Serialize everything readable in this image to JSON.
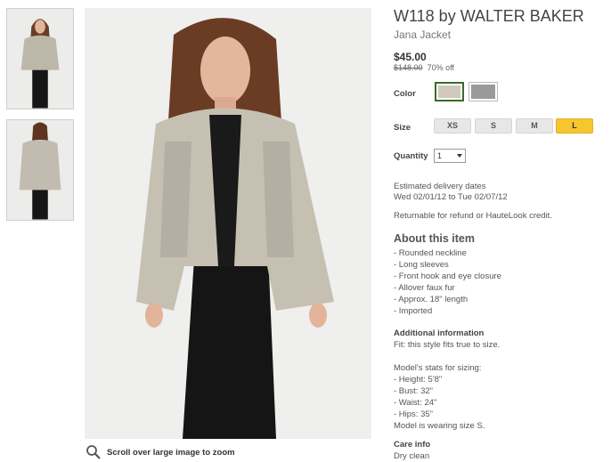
{
  "gallery": {
    "zoom_hint": "Scroll over large image to zoom"
  },
  "product": {
    "brand_line": "W118 by WALTER BAKER",
    "name": "Jana Jacket",
    "price": "$45.00",
    "original_price": "$148.00",
    "discount": "70% off"
  },
  "options": {
    "color_label": "Color",
    "colors": [
      {
        "name": "light faux fur",
        "hex": "#cfc9bd",
        "selected": true
      },
      {
        "name": "grey faux fur",
        "hex": "#9a9a9a",
        "selected": false
      }
    ],
    "size_label": "Size",
    "sizes": [
      "XS",
      "S",
      "M",
      "L"
    ],
    "selected_size": "L",
    "quantity_label": "Quantity",
    "quantity_value": "1"
  },
  "delivery": {
    "heading": "Estimated delivery dates",
    "dates": "Wed 02/01/12 to Tue 02/07/12",
    "returns": "Returnable for refund or HauteLook credit."
  },
  "about": {
    "heading": "About this item",
    "bullets": [
      "- Rounded neckline",
      "- Long sleeves",
      "- Front hook and eye closure",
      "- Allover faux fur",
      "- Approx. 18\" length",
      "- Imported"
    ]
  },
  "additional": {
    "heading": "Additional information",
    "fit": "Fit: this style fits true to size.",
    "model_heading": "Model's stats for sizing:",
    "model_stats": [
      "- Height: 5'8\"",
      "- Bust: 32\"",
      "- Waist: 24\"",
      "- Hips: 35\""
    ],
    "model_size": "Model is wearing size S."
  },
  "care": {
    "heading": "Care info",
    "value": "Dry clean"
  },
  "colors": {
    "selected_size_bg": "#f5c630",
    "size_bg": "#e7e7e7",
    "photo_bg": "#efefed"
  }
}
